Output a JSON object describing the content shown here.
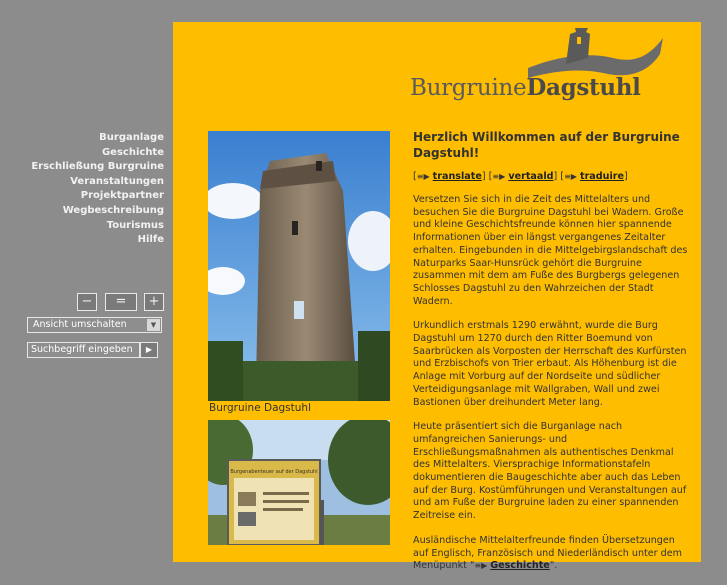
{
  "logo": {
    "text_light": "Burgruine",
    "text_bold": "Dagstuhl"
  },
  "nav": {
    "items": [
      "Burganlage",
      "Geschichte",
      "Erschließung Burgruine",
      "Veranstaltungen",
      "Projektpartner",
      "Wegbeschreibung",
      "Tourismus",
      "Hilfe"
    ]
  },
  "controls": {
    "zoom_out": "−",
    "zoom_reset": "=",
    "zoom_in": "+",
    "view_switch": "Ansicht umschalten",
    "search_placeholder": "Suchbegriff eingeben"
  },
  "images": {
    "caption1": "Burgruine Dagstuhl",
    "sign_title": "Burgenabenteuer auf der Dagstuhl"
  },
  "content": {
    "heading": "Herzlich Willkommen auf der Burgruine Dagstuhl!",
    "languages": [
      "translate",
      "vertaald",
      "traduire"
    ],
    "para1": "Versetzen Sie sich in die Zeit des Mittelalters und besuchen Sie die Burgruine Dagstuhl bei Wadern. Große und kleine Geschichtsfreunde können hier spannende Informationen über ein längst vergangenes Zeitalter erhalten. Eingebunden in die Mittelgebirgslandschaft des Naturparks Saar-Hunsrück gehört die Burgruine zusammen mit dem am Fuße des Burgbergs gelegenen Schlosses Dagstuhl zu den Wahrzeichen der Stadt Wadern.",
    "para2": "Urkundlich erstmals 1290 erwähnt, wurde die Burg Dagstuhl um 1270 durch den Ritter Boemund von Saarbrücken als Vorposten der Herrschaft des Kurfürsten und Erzbischofs von Trier erbaut. Als Höhenburg ist die Anlage mit Vorburg auf der Nordseite und südlicher Verteidigungsanlage mit Wallgraben, Wall und zwei Bastionen über dreihundert Meter lang.",
    "para3": "Heute präsentiert sich die Burganlage nach umfangreichen Sanierungs- und Erschließungsmaßnahmen als authentisches Denkmal des Mittelalters. Viersprachige Informationstafeln dokumentieren die Baugeschichte aber auch das Leben auf der Burg. Kostümführungen und Veranstaltungen auf und am Fuße der Burgruine laden zu einer spannenden Zeitreise ein.",
    "para4_pre": "Ausländische Mittelalterfreunde finden Übersetzungen auf Englisch, Französisch und Niederländisch unter dem Menüpunkt \"",
    "para4_link": "Geschichte",
    "para4_post": "\"."
  },
  "colors": {
    "panel": "#ffbd00",
    "background": "#8c8c8c"
  }
}
